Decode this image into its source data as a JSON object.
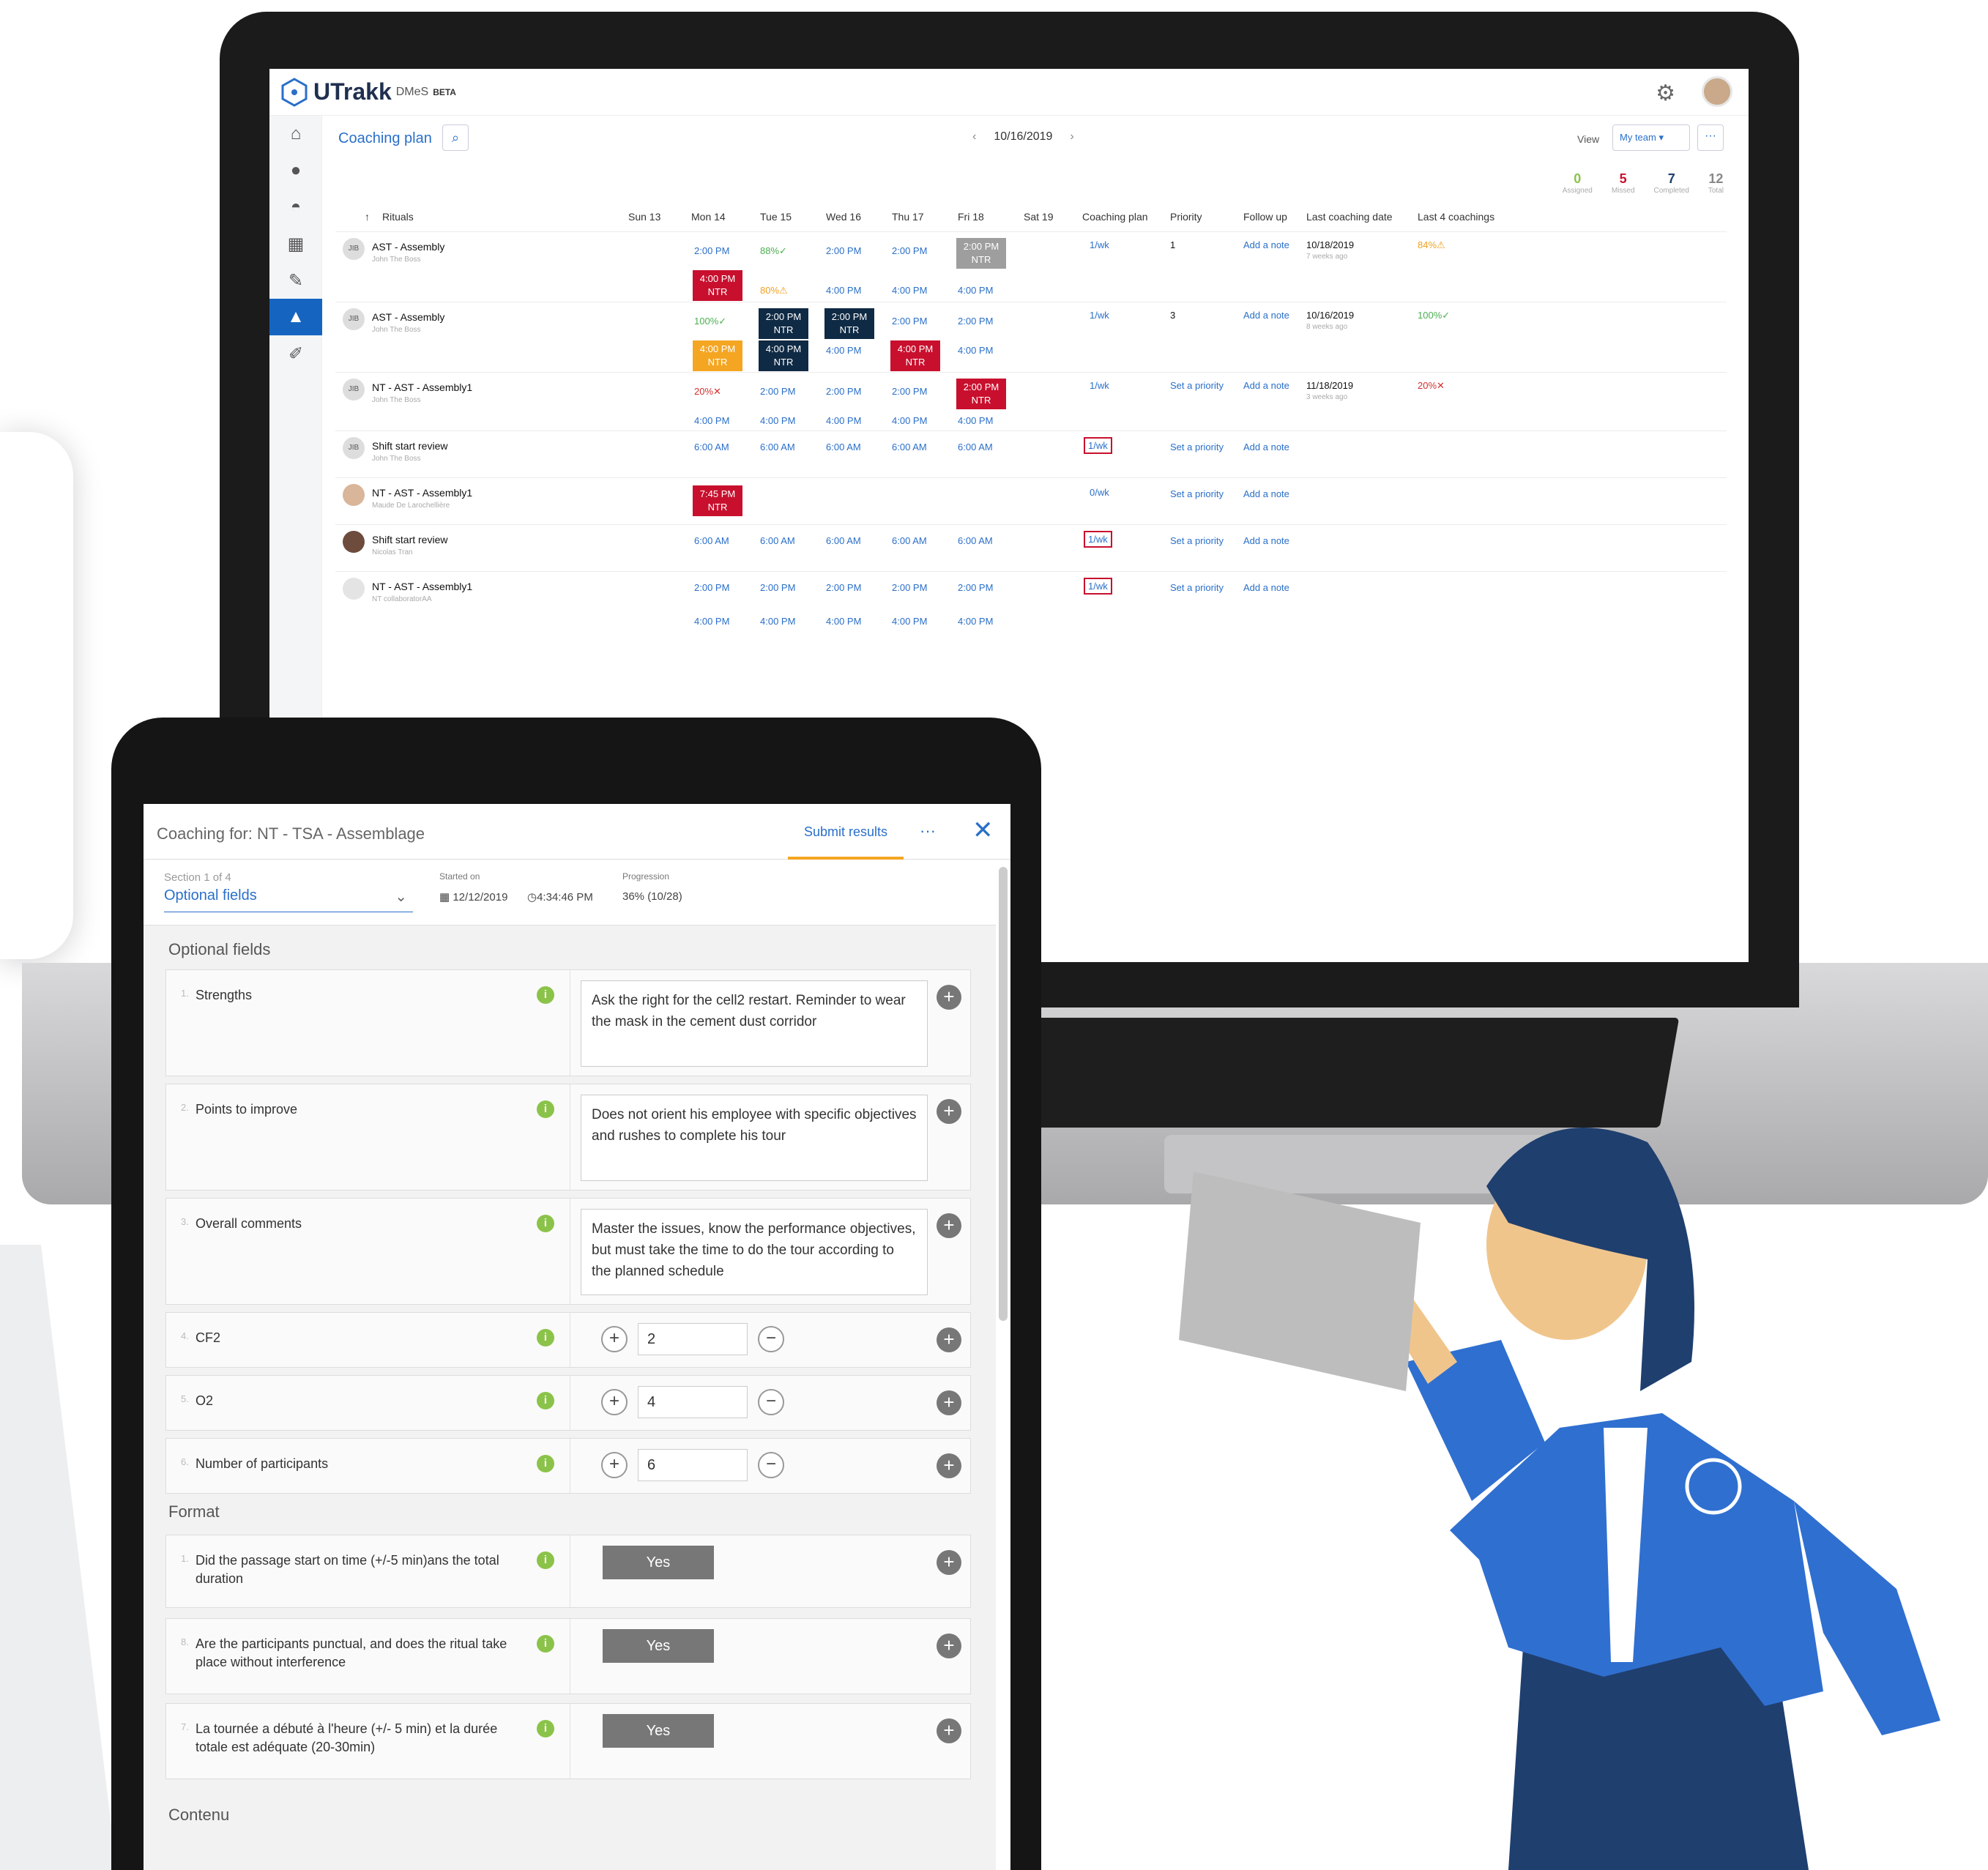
{
  "app": {
    "brand": "UTrakk",
    "brand_suffix": "DMeS",
    "brand_badge": "BETA",
    "page_title": "Coaching plan",
    "date": "10/16/2019",
    "view_label": "View",
    "view_value": "My team",
    "more": "···",
    "stats": [
      {
        "value": "0",
        "label": "Assigned",
        "color": "#8bc34a"
      },
      {
        "value": "5",
        "label": "Missed",
        "color": "#c8102e"
      },
      {
        "value": "7",
        "label": "Completed",
        "color": "#1f3f6f"
      },
      {
        "value": "12",
        "label": "Total",
        "color": "#888888"
      }
    ],
    "columns": [
      "Rituals",
      "Sun 13",
      "Mon 14",
      "Tue 15",
      "Wed 16",
      "Thu 17",
      "Fri 18",
      "Sat 19",
      "Coaching plan",
      "Priority",
      "Follow up",
      "Last coaching date",
      "Last 4 coachings"
    ],
    "rows": [
      {
        "avatar": "JIB",
        "name": "AST - Assembly",
        "sub": "John The Boss",
        "plan": "1/wk",
        "priority": "1",
        "follow": "Add a note",
        "last": "10/18/2019",
        "last_sub": "7 weeks ago",
        "last4": "84%",
        "mon1": "2:00 PM",
        "tue1": "88%",
        "wed1": "2:00 PM",
        "thu1": "2:00 PM",
        "fri1_tag": "2:00 PM",
        "fri1_tag2": "NTR",
        "mon2_tag": "4:00 PM",
        "mon2_tag2": "NTR",
        "tue2": "80%",
        "wed2": "4:00 PM",
        "thu2": "4:00 PM",
        "fri2": "4:00 PM"
      },
      {
        "avatar": "JIB",
        "name": "AST - Assembly",
        "sub": "John The Boss",
        "plan": "1/wk",
        "priority": "3",
        "follow": "Add a note",
        "last": "10/16/2019",
        "last_sub": "8 weeks ago",
        "last4": "100%",
        "mon1": "100%",
        "tue1_tag": "2:00 PM",
        "tue1_tag2": "NTR",
        "wed1_tag": "2:00 PM",
        "wed1_tag2": "NTR",
        "thu1": "2:00 PM",
        "fri1": "2:00 PM",
        "mon2_tag": "4:00 PM",
        "mon2_tag2": "NTR",
        "tue2_tag": "4:00 PM",
        "tue2_tag2": "NTR",
        "wed2": "4:00 PM",
        "thu2_tag": "4:00 PM",
        "thu2_tag2": "NTR",
        "fri2": "4:00 PM"
      },
      {
        "avatar": "JIB",
        "name": "NT - AST - Assembly1",
        "sub": "John The Boss",
        "plan": "1/wk",
        "priority": "Set a priority",
        "follow": "Add a note",
        "last": "11/18/2019",
        "last_sub": "3 weeks ago",
        "last4": "20%",
        "mon1": "20%",
        "tue1": "2:00 PM",
        "wed1": "2:00 PM",
        "thu1": "2:00 PM",
        "fri1_tag": "2:00 PM",
        "fri1_tag2": "NTR",
        "mon2": "4:00 PM",
        "tue2": "4:00 PM",
        "wed2": "4:00 PM",
        "thu2": "4:00 PM",
        "fri2": "4:00 PM"
      },
      {
        "avatar": "JIB",
        "name": "Shift start review",
        "sub": "John The Boss",
        "plan": "1/wk",
        "priority": "Set a priority",
        "follow": "Add a note",
        "time": "6:00 AM"
      },
      {
        "avatar": "",
        "name": "NT - AST - Assembly1",
        "sub": "Maude De Larochellière",
        "plan": "0/wk",
        "priority": "Set a priority",
        "follow": "Add a note",
        "mon_tag": "7:45 PM",
        "mon_tag2": "NTR"
      },
      {
        "avatar": "",
        "name": "Shift start review",
        "sub": "Nicolas Tran",
        "plan": "1/wk",
        "priority": "Set a priority",
        "follow": "Add a note",
        "time": "6:00 AM"
      },
      {
        "avatar": "",
        "name": "NT - AST - Assembly1",
        "sub": "NT collaboratorAA",
        "plan": "1/wk",
        "priority": "Set a priority",
        "follow": "Add a note",
        "time": "2:00 PM",
        "time2": "4:00 PM"
      }
    ]
  },
  "coaching": {
    "title": "Coaching for: NT - TSA - Assemblage",
    "submit": "Submit results",
    "more": "···",
    "close": "✕",
    "section_label": "Section 1 of 4",
    "section_value": "Optional fields",
    "started_label": "Started on",
    "started_date": "12/12/2019",
    "started_time": "4:34:46 PM",
    "progress_label": "Progression",
    "progress_value": "36% (10/28)",
    "progress": 0.36,
    "groups": [
      "Optional fields",
      "Format",
      "Contenu"
    ],
    "questions": [
      {
        "num": "1.",
        "label": "Strengths",
        "answer": "Ask the right for the cell2 restart. Reminder to wear the mask in the cement dust corridor"
      },
      {
        "num": "2.",
        "label": "Points to improve",
        "answer": "Does not orient his employee with specific objectives and rushes to complete his tour"
      },
      {
        "num": "3.",
        "label": "Overall comments",
        "answer": "Master the issues, know the performance objectives, but must take the time to do the tour according to the planned schedule"
      },
      {
        "num": "4.",
        "label": "CF2",
        "value": "2"
      },
      {
        "num": "5.",
        "label": "O2",
        "value": "4"
      },
      {
        "num": "6.",
        "label": "Number of participants",
        "value": "6"
      },
      {
        "num": "1.",
        "label": "Did the passage start on time (+/-5 min)ans the total duration",
        "choice": "Yes"
      },
      {
        "num": "8.",
        "label": "Are the participants punctual, and does the ritual take place without interference",
        "choice": "Yes"
      },
      {
        "num": "7.",
        "label": "La tournée a débuté à l'heure (+/- 5 min) et la durée totale est adéquate (20-30min)",
        "choice": "Yes"
      }
    ]
  },
  "colors": {
    "accent": "#2a6fc9",
    "missed": "#c8102e",
    "navy": "#0f2a44",
    "warning": "#f4a623",
    "success": "#8bc34a"
  }
}
